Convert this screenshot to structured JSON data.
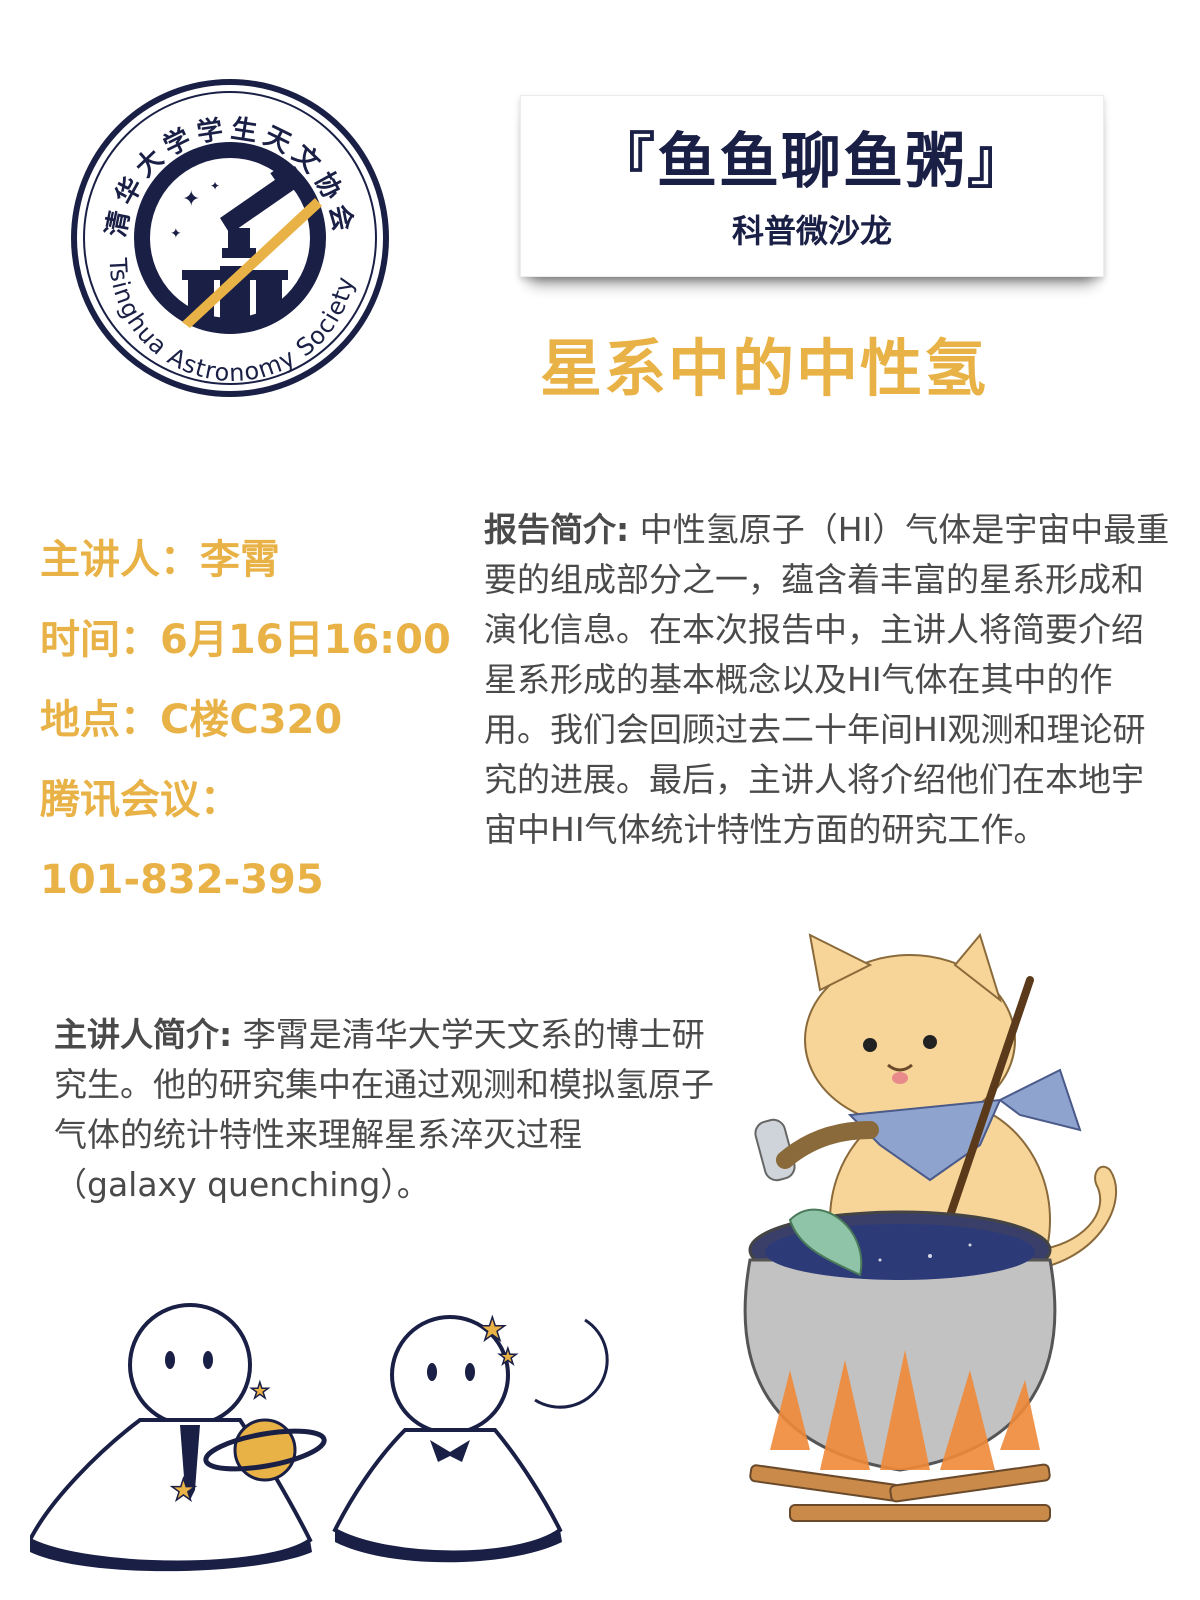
{
  "logo": {
    "text_cn": "清华大学学生天文协会",
    "text_en": "Tsinghua Astronomy Society"
  },
  "title": {
    "main": "『鱼鱼聊鱼粥』",
    "sub": "科普微沙龙"
  },
  "topic": "星系中的中性氢",
  "info": {
    "speaker": "主讲人：李霄",
    "time": "时间：6月16日16:00",
    "place": "地点：C楼C320",
    "meeting_label": "腾讯会议：",
    "meeting_id": "101-832-395"
  },
  "abstract": {
    "label": "报告简介:",
    "text": " 中性氢原子（HI）气体是宇宙中最重要的组成部分之一，蕴含着丰富的星系形成和演化信息。在本次报告中，主讲人将简要介绍星系形成的基本概念以及HI气体在其中的作用。我们会回顾过去二十年间HI观测和理论研究的进展。最后，主讲人将介绍他们在本地宇宙中HI气体统计特性方面的研究工作。"
  },
  "bio": {
    "label": "主讲人简介:",
    "text": " 李霄是清华大学天文系的博士研究生。他的研究集中在通过观测和模拟氢原子气体的统计特性来理解星系淬灭过程（galaxy quenching）。"
  },
  "colors": {
    "accent": "#e9b246",
    "navy": "#1a1f45",
    "body_text": "#4a4a4a"
  }
}
